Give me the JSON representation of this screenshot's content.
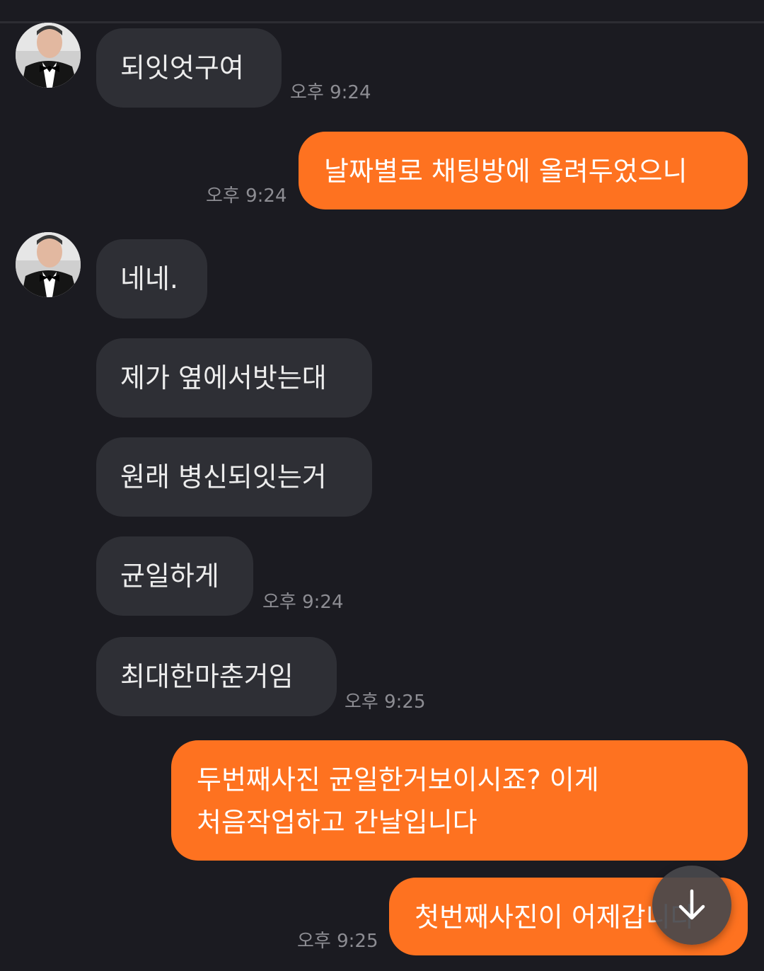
{
  "messages": {
    "m1": {
      "text": "되잇엇구여",
      "time": "오후 9:24"
    },
    "m2": {
      "text": "날짜별로 채팅방에 올려두었으니",
      "time": "오후 9:24"
    },
    "m3": {
      "text": "네네."
    },
    "m4": {
      "text": "제가 옆에서밧는대"
    },
    "m5": {
      "text": "원래 병신되잇는거"
    },
    "m6": {
      "text": "균일하게",
      "time": "오후 9:24"
    },
    "m7": {
      "text": "최대한마춘거임",
      "time": "오후 9:25"
    },
    "m8": {
      "line1": "두번째사진 균일한거보이시죠? 이게",
      "line2": "처음작업하고 간날입니다"
    },
    "m9": {
      "text": "첫번째사진이 어제갑니다",
      "time": "오후 9:25"
    }
  },
  "icons": {
    "avatar": "profile-photo-man-in-tuxedo",
    "scroll": "arrow-down-icon"
  },
  "colors": {
    "background": "#1b1b21",
    "incoming_bubble": "#2e2f35",
    "outgoing_bubble": "#fe7220",
    "timestamp": "#8d8d93"
  }
}
